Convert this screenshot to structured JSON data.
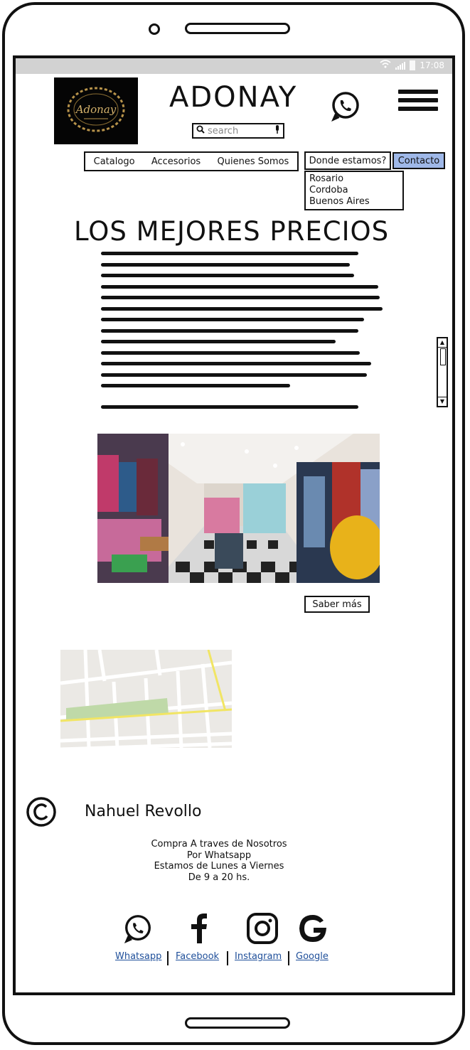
{
  "status_bar": {
    "time": "17:08"
  },
  "header": {
    "brand": "ADONAY",
    "logo_text": "Adonay",
    "search_placeholder": "search",
    "icons": [
      "whatsapp-icon",
      "hamburger-menu-icon",
      "search-icon",
      "microphone-icon"
    ]
  },
  "nav": {
    "items": [
      "Catalogo",
      "Accesorios",
      "Quienes Somos"
    ],
    "dropdown_label": "Donde estamos?",
    "dropdown_options": [
      "Rosario",
      "Cordoba",
      "Buenos Aires"
    ],
    "contact_label": "Contacto"
  },
  "main": {
    "headline": "LOS MEJORES PRECIOS",
    "button_label": "Saber más"
  },
  "footer": {
    "author": "Nahuel Revollo",
    "note_lines": [
      "Compra A traves de Nosotros",
      "Por Whatsapp",
      "Estamos de Lunes a Viernes",
      "De 9 a 20 hs."
    ],
    "links": [
      "Whatsapp",
      "Facebook",
      "Instagram",
      "Google"
    ]
  },
  "colors": {
    "contact_bg": "#9fb8e8",
    "link": "#1f4f9a",
    "map_bg": "#ebe9e5",
    "map_road": "#f1e564",
    "map_park": "#bfd9a8"
  }
}
